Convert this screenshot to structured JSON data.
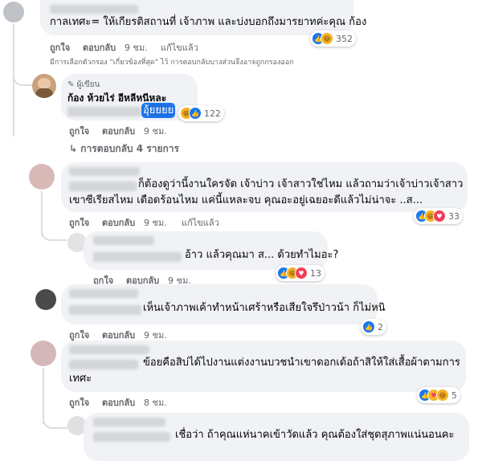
{
  "comments": [
    {
      "id": "c1",
      "text": "กาลเทศะ= ให้เกียรติสถานที่ เจ้าภาพ และบ่งบอกถึงมารยาทค่ะคุณ ก้อง",
      "time": "9 ชม.",
      "like_label": "ถูกใจ",
      "reply_label": "ตอบกลับ",
      "edited_label": "แก้ไขแล้ว",
      "reaction_count": "352",
      "filter_note": "มีการเลือกตัวกรอง \"เกี่ยวข้องที่สุด\" ไว้ การตอบกลับบางส่วนจึงอาจถูกกรองออก"
    },
    {
      "id": "c2",
      "badge": "ผู้เขียน",
      "author": "ก้อง ห้วยไร่ อีหลีหนีหละ",
      "text_highlight": "อุ้ยยยย",
      "time": "9 ชม.",
      "like_label": "ถูกใจ",
      "reply_label": "ตอบกลับ",
      "reaction_count": "122",
      "replies_label": "การตอบกลับ 4 รายการ"
    },
    {
      "id": "c3",
      "line1": "ก็ต้องดูว่านี้งานใครจัด เจ้าบ่าว เจ้าสาวใช่ไหม แล้วถามว่าเจ้าบ่าวเจ้าสาว",
      "line2": "เขาซีเรียสไหม เดือดร้อนไหม แค่นี้แหละจบ คุณอะอยู่เฉยอะดีแล้วไม่น่าจะ ..ส...",
      "time": "9 ชม.",
      "like_label": "ถูกใจ",
      "reply_label": "ตอบกลับ",
      "edited_label": "แก้ไขแล้ว",
      "reaction_count": "33"
    },
    {
      "id": "c4",
      "text": "อ้าว แล้วคุณมา ส... ด้วยทำไมอะ?",
      "time": "9 ชม.",
      "like_label": "ถูกใจ",
      "reply_label": "ตอบกลับ",
      "reaction_count": "13"
    },
    {
      "id": "c5",
      "text": "เห็นเจ้าภาพเค้าทำหน้าเศร้าหรือเสียใจรึป่าวน้า ก็ไม่หนิ",
      "time": "9 ชม.",
      "like_label": "ถูกใจ",
      "reply_label": "ตอบกลับ",
      "reaction_count": "2"
    },
    {
      "id": "c6",
      "line1": "ข้อยคือสิบ่ได้ไปงานแต่งงานบวชนำเขาดอกเด้อถ้าสิให้ใส่เสื้อผ้าตามการ",
      "line2": "เทศะ",
      "time": "8 ชม.",
      "like_label": "ถูกใจ",
      "reply_label": "ตอบกลับ",
      "reaction_count": "5"
    },
    {
      "id": "c7",
      "text": "เชื่อว่า ถ้าคุณแห่นาคเข้าวัดแล้ว คุณต้องใส่ชุดสุภาพแน่นอนคะ"
    }
  ],
  "colors": {
    "bubble": "#f0f2f5",
    "secondary_text": "#65676b",
    "like_blue": "#1877f2",
    "love_red": "#f33e58",
    "haha_yellow": "#f7b125"
  }
}
